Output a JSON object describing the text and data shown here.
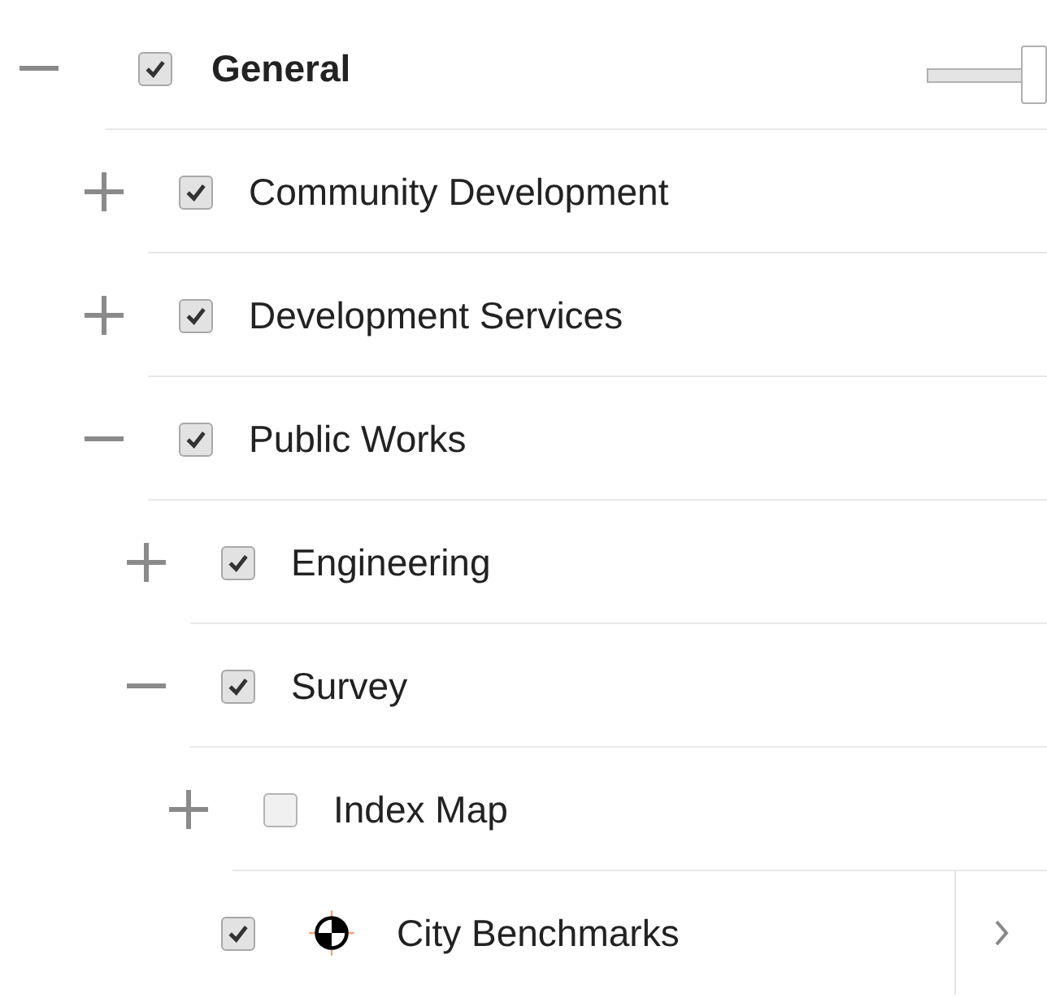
{
  "layers": [
    {
      "kind": "group",
      "label": "General",
      "expanded": true,
      "checked": true,
      "opacity_slider": {
        "level": 1
      },
      "children": [
        {
          "kind": "group",
          "label": "Community Development",
          "expanded": false,
          "checked": true
        },
        {
          "kind": "group",
          "label": "Development Services",
          "expanded": false,
          "checked": true
        },
        {
          "kind": "group",
          "label": "Public Works",
          "expanded": true,
          "checked": true,
          "children": [
            {
              "kind": "group",
              "label": "Engineering",
              "expanded": false,
              "checked": true
            },
            {
              "kind": "group",
              "label": "Survey",
              "expanded": true,
              "checked": true,
              "children": [
                {
                  "kind": "group",
                  "label": "Index Map",
                  "expanded": false,
                  "checked": false
                },
                {
                  "kind": "layer",
                  "label": "City Benchmarks",
                  "checked": true
                }
              ]
            }
          ]
        }
      ]
    }
  ]
}
